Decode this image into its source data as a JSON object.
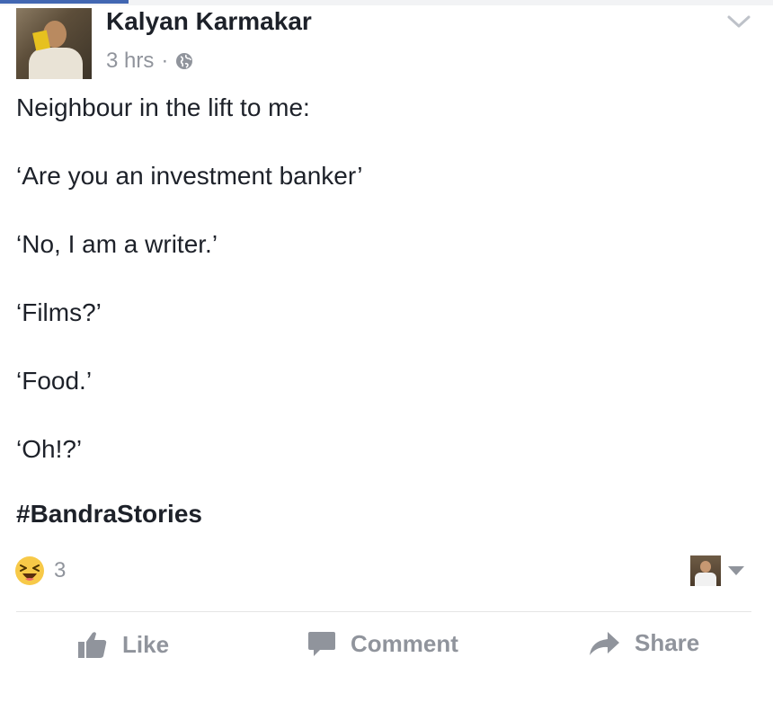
{
  "post": {
    "author": "Kalyan Karmakar",
    "time": "3 hrs",
    "separator": "·",
    "privacy_icon": "globe-icon",
    "menu_icon": "chevron-down-icon",
    "lines": [
      "Neighbour in the lift to me:",
      "‘Are you an investment banker’",
      "‘No, I am a writer.’",
      "‘Films?’",
      "‘Food.’",
      "‘Oh!?’"
    ],
    "hashtag": "#BandraStories"
  },
  "reactions": {
    "emoji_icon": "haha-emoji-icon",
    "count": "3"
  },
  "actions": {
    "like": "Like",
    "comment": "Comment",
    "share": "Share"
  },
  "colors": {
    "accent": "#4267b2",
    "text": "#1d2129",
    "muted": "#90949c"
  }
}
